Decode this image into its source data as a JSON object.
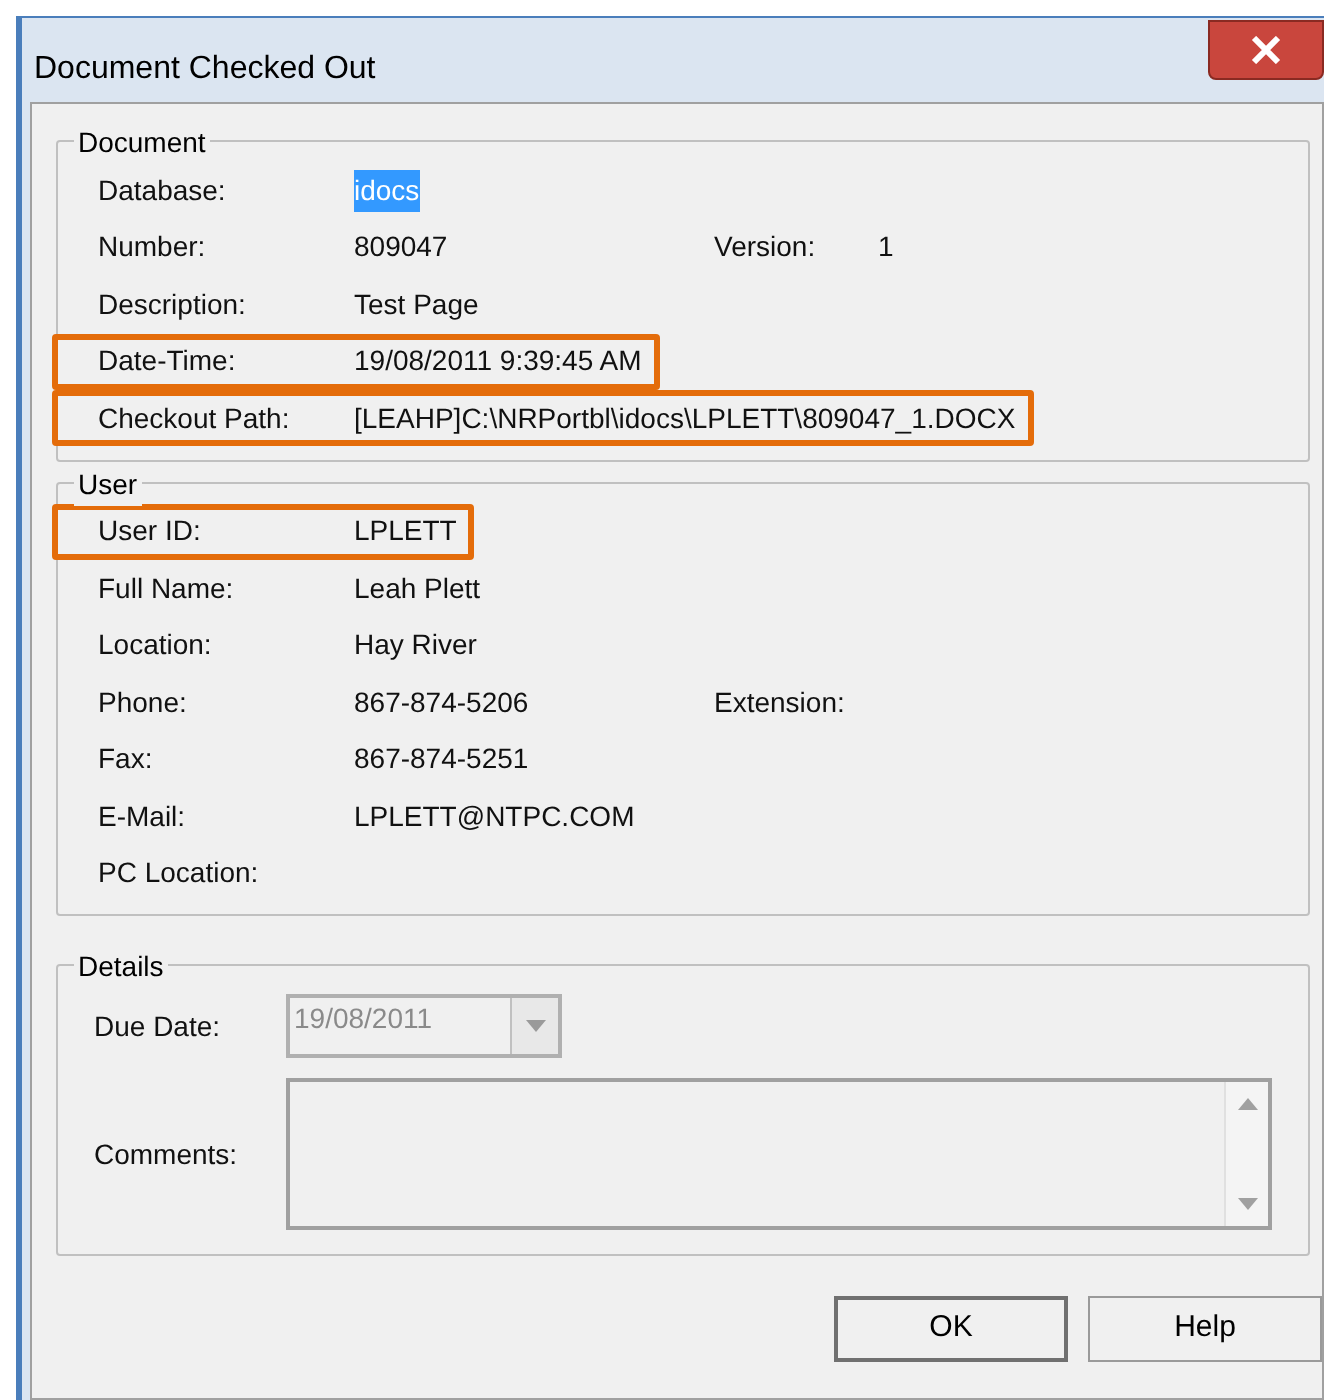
{
  "window": {
    "title": "Document Checked Out"
  },
  "document": {
    "legend": "Document",
    "fields": [
      {
        "label": "Database:",
        "value": "idocs",
        "selected": true,
        "highlighted": false
      },
      {
        "label": "Number:",
        "value": "809047",
        "selected": false,
        "highlighted": false,
        "extra_label": "Version:",
        "extra_value": "1"
      },
      {
        "label": "Description:",
        "value": "Test Page",
        "selected": false,
        "highlighted": false
      },
      {
        "label": "Date-Time:",
        "value": "19/08/2011 9:39:45 AM",
        "selected": false,
        "highlighted": true
      },
      {
        "label": "Checkout Path:",
        "value": "[LEAHP]C:\\NRPortbl\\idocs\\LPLETT\\809047_1.DOCX",
        "selected": false,
        "highlighted": true
      }
    ]
  },
  "user": {
    "legend": "User",
    "fields": [
      {
        "label": "User ID:",
        "value": "LPLETT",
        "highlighted": true
      },
      {
        "label": "Full Name:",
        "value": "Leah Plett",
        "highlighted": false
      },
      {
        "label": "Location:",
        "value": "Hay River",
        "highlighted": false
      },
      {
        "label": "Phone:",
        "value": "867-874-5206",
        "highlighted": false,
        "extra_label": "Extension:"
      },
      {
        "label": "Fax:",
        "value": "867-874-5251",
        "highlighted": false
      },
      {
        "label": "E-Mail:",
        "value": "LPLETT@NTPC.COM",
        "highlighted": false
      },
      {
        "label": "PC Location:",
        "highlighted": false
      }
    ]
  },
  "details": {
    "legend": "Details",
    "due_date": {
      "label": "Due Date:",
      "value": "19/08/2011",
      "disabled": true
    },
    "comments": {
      "label": "Comments:"
    }
  },
  "buttons": [
    {
      "label": "OK",
      "default": true
    },
    {
      "label": "Help",
      "default": false
    }
  ]
}
